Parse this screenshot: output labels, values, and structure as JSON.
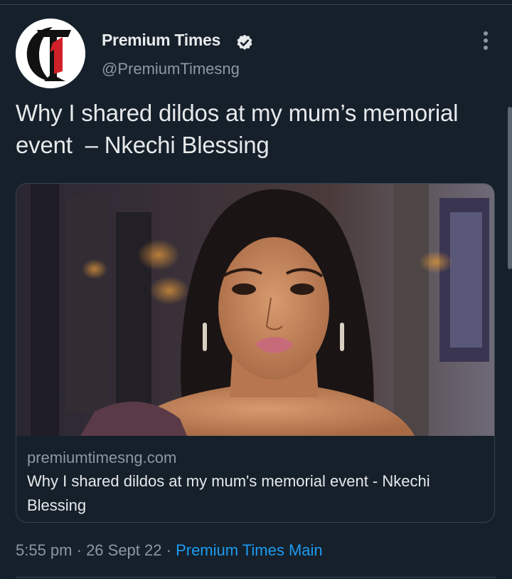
{
  "tweet": {
    "author_name": "Premium Times",
    "author_handle": "@PremiumTimesng",
    "text": "Why I shared dildos at my mum’s memorial event  – Nkechi Blessing",
    "avatar_icon": "premium-times-logo",
    "verified_icon": "verified-badge-icon",
    "more_icon": "more-options-icon"
  },
  "card": {
    "image_icon": "portrait-photo",
    "domain": "premiumtimesng.com",
    "title": "Why I shared dildos at my mum's memorial event - Nkechi Blessing"
  },
  "meta": {
    "time": "5:55 pm",
    "separator": " · ",
    "date": "26 Sept 22",
    "source": "Premium Times Main"
  },
  "colors": {
    "background": "#15202b",
    "text": "#e7e9ea",
    "secondary": "#8b98a5",
    "link": "#1d9bf0",
    "border": "#38444d"
  }
}
